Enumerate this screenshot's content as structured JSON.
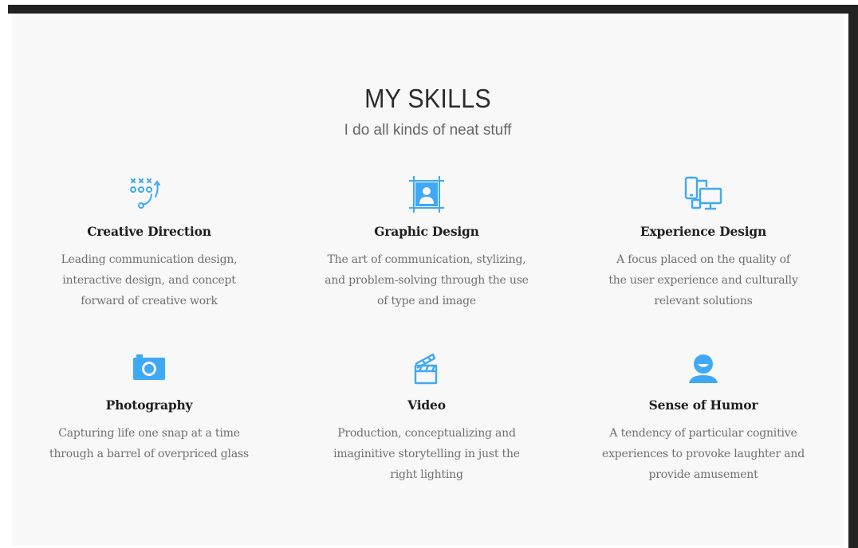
{
  "header": {
    "title": "MY SKILLS",
    "subtitle": "I do all kinds of neat stuff"
  },
  "colors": {
    "accent": "#3fa9f5",
    "panel": "#f8f8f8",
    "frame": "#222222"
  },
  "skills": [
    {
      "icon": "strategy-play-icon",
      "title": "Creative Direction",
      "lines": [
        "Leading communication design,",
        "interactive design, and concept",
        "forward of creative work"
      ]
    },
    {
      "icon": "portrait-frame-icon",
      "title": "Graphic Design",
      "lines": [
        "The art of communication, stylizing,",
        "and problem-solving through the use",
        "of type and image"
      ]
    },
    {
      "icon": "devices-icon",
      "title": "Experience Design",
      "lines": [
        "A focus placed on the quality of",
        "the user experience and culturally",
        "relevant solutions"
      ]
    },
    {
      "icon": "camera-icon",
      "title": "Photography",
      "lines": [
        "Capturing life one snap at a time",
        "through a barrel of overpriced glass"
      ]
    },
    {
      "icon": "clapperboard-icon",
      "title": "Video",
      "lines": [
        "Production, conceptualizing and",
        "imaginitive storytelling in just the",
        "right lighting"
      ]
    },
    {
      "icon": "smiley-person-icon",
      "title": "Sense of Humor",
      "lines": [
        "A tendency of particular cognitive",
        "experiences to provoke laughter and",
        "provide amusement"
      ]
    }
  ]
}
